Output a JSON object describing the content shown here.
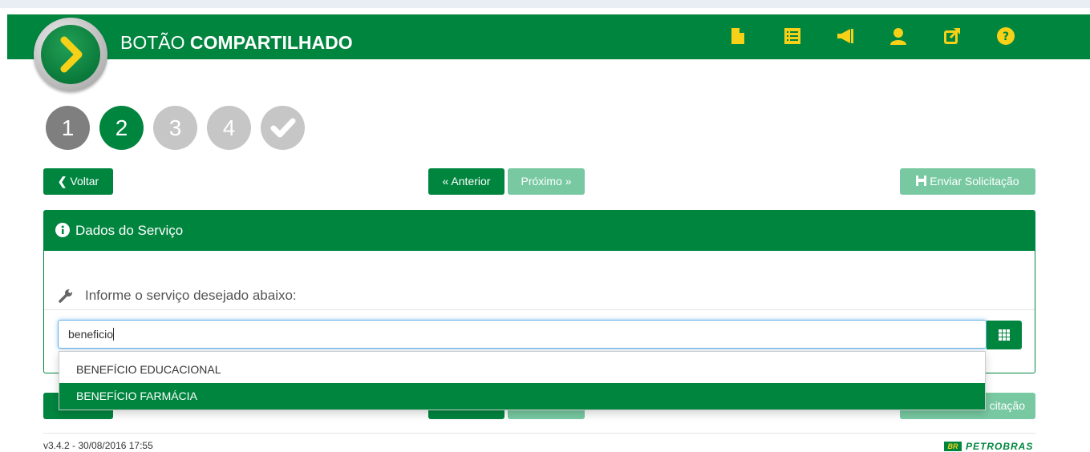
{
  "header": {
    "brand_light": "BOTÃO",
    "brand_bold": "COMPARTILHADO",
    "icons": [
      "document-icon",
      "list-icon",
      "megaphone-icon",
      "user-icon",
      "external-link-icon",
      "help-icon"
    ],
    "icon_color": "#f7d117",
    "bg_color": "#00853f"
  },
  "steps": {
    "items": [
      {
        "label": "1",
        "state": "done"
      },
      {
        "label": "2",
        "state": "current"
      },
      {
        "label": "3",
        "state": "pending"
      },
      {
        "label": "4",
        "state": "pending"
      },
      {
        "label": "",
        "icon": "check-icon",
        "state": "pending"
      }
    ]
  },
  "nav": {
    "back": "Voltar",
    "previous": "« Anterior",
    "next": "Próximo »",
    "submit": "Enviar Solicitação"
  },
  "panel": {
    "title": "Dados do Serviço",
    "prompt": "Informe o serviço desejado abaixo:"
  },
  "search": {
    "value": "beneficio"
  },
  "dropdown": {
    "options": [
      "BENEFÍCIO EDUCACIONAL",
      "BENEFÍCIO FARMÁCIA"
    ],
    "highlighted_index": 1
  },
  "bottom_nav": {
    "submit_partial": "citação"
  },
  "footer": {
    "version": "v3.4.2 - 30/08/2016 17:55",
    "company": "PETROBRAS",
    "company_badge": "BR"
  }
}
